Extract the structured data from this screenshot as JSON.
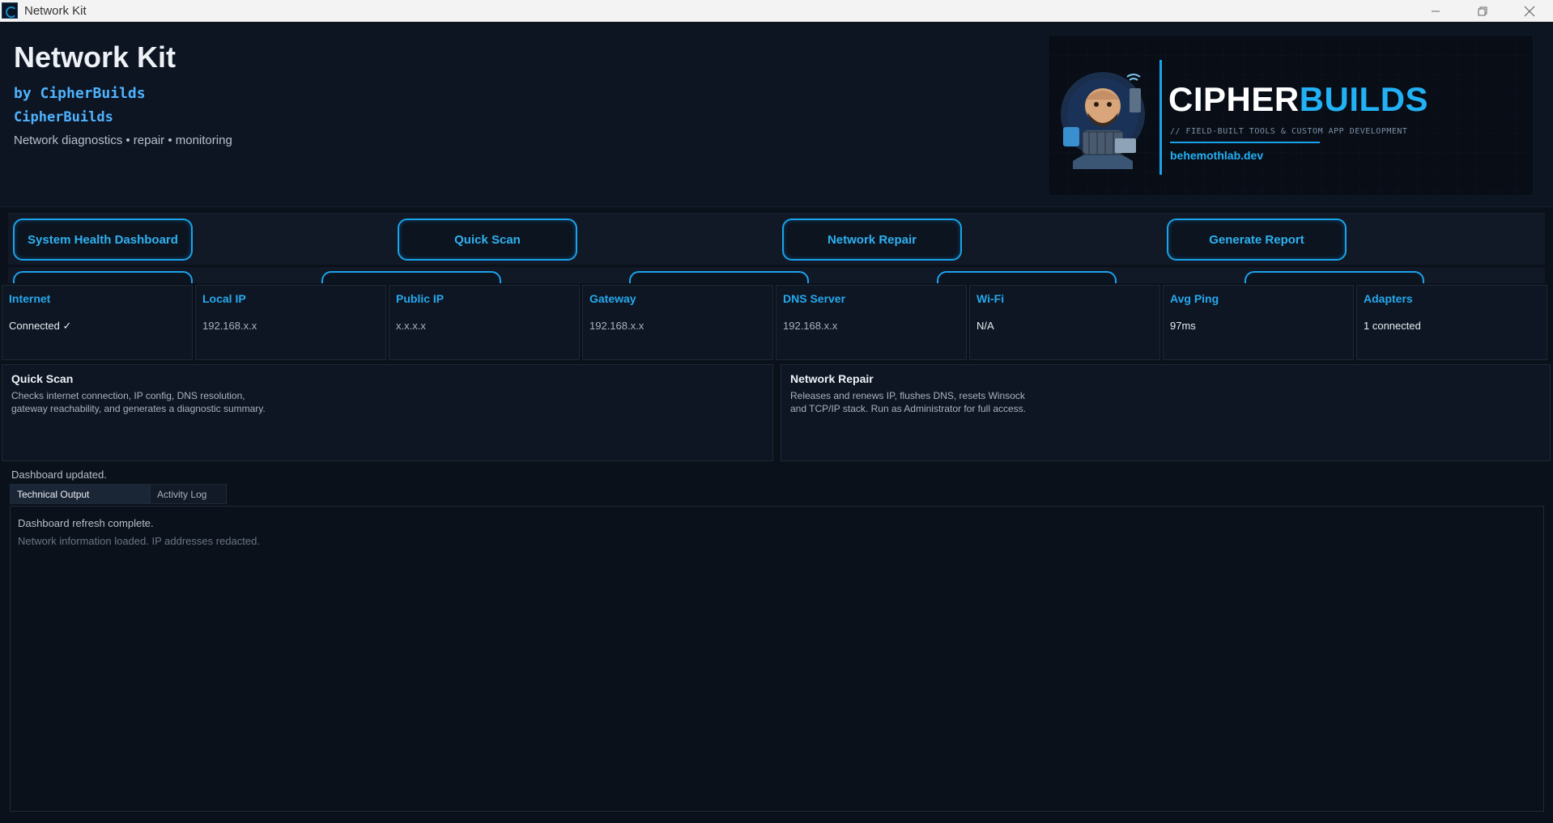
{
  "window": {
    "title": "Network Kit",
    "controls": [
      "minimize",
      "restore",
      "close"
    ]
  },
  "header": {
    "app_name": "Network Kit",
    "byline": "by CipherBuilds",
    "brand": "CipherBuilds",
    "tagline": "Network diagnostics  •  repair  •  monitoring"
  },
  "logo": {
    "word_part1": "CIPHER",
    "word_part2": "BUILDS",
    "subtitle": "// FIELD-BUILT TOOLS & CUSTOM APP DEVELOPMENT",
    "url": "behemothlab.dev"
  },
  "actions": [
    {
      "label": "System Health Dashboard"
    },
    {
      "label": "Quick Scan"
    },
    {
      "label": "Network Repair"
    },
    {
      "label": "Generate Report"
    }
  ],
  "stats": [
    {
      "label": "Internet",
      "value": "Connected ✓",
      "value_color": "#e8edf2"
    },
    {
      "label": "Local IP",
      "value": "192.168.x.x",
      "value_color": "#a8b2be"
    },
    {
      "label": "Public IP",
      "value": "x.x.x.x",
      "value_color": "#a8b2be"
    },
    {
      "label": "Gateway",
      "value": "192.168.x.x",
      "value_color": "#a8b2be"
    },
    {
      "label": "DNS Server",
      "value": "192.168.x.x",
      "value_color": "#a8b2be"
    },
    {
      "label": "Wi-Fi",
      "value": "N/A",
      "value_color": "#e8edf2"
    },
    {
      "label": "Avg Ping",
      "value": "97ms",
      "value_color": "#e8edf2"
    },
    {
      "label": "Adapters",
      "value": "1 connected",
      "value_color": "#e8edf2"
    }
  ],
  "info": {
    "quick_scan": {
      "title": "Quick Scan",
      "description": "Checks internet connection, IP config, DNS resolution,\ngateway reachability, and generates a diagnostic summary."
    },
    "network_repair": {
      "title": "Network Repair",
      "description": "Releases and renews IP, flushes DNS, resets Winsock\nand TCP/IP stack. Run as Administrator for full access."
    }
  },
  "status": "Dashboard updated.",
  "tabs": [
    {
      "label": "Technical Output",
      "active": true
    },
    {
      "label": "Activity Log",
      "active": false
    }
  ],
  "output": {
    "line1": "Dashboard refresh complete.",
    "line2": "Network information loaded. IP addresses redacted."
  },
  "colors": {
    "accent": "#1aa3ec",
    "label_blue": "#26a9ee",
    "background": "#0b111b"
  }
}
